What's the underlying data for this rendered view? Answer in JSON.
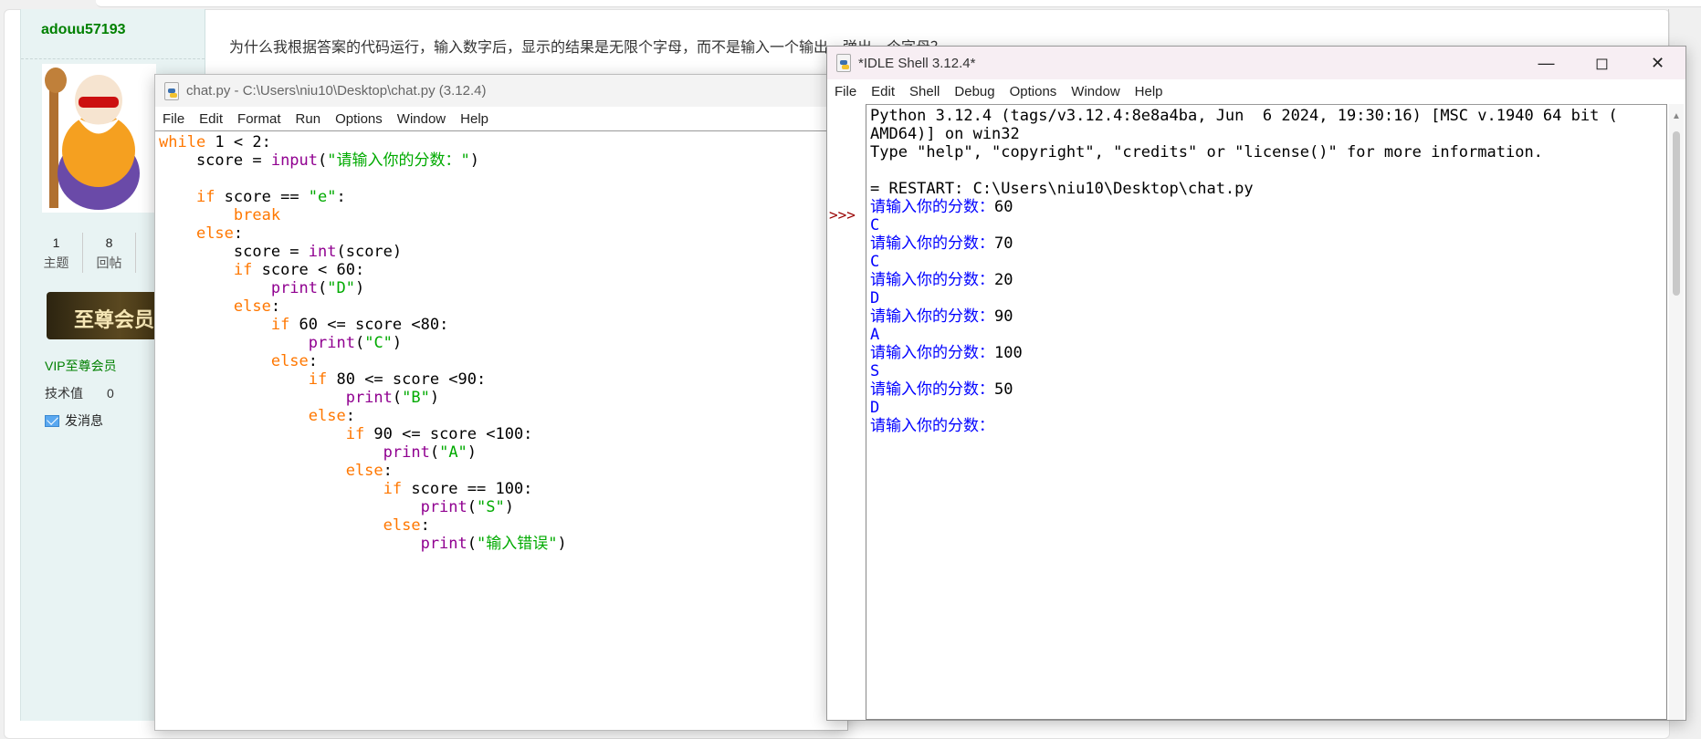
{
  "forum": {
    "username": "adouu57193",
    "stats": [
      {
        "value": "1",
        "label": "主题"
      },
      {
        "value": "8",
        "label": "回帖"
      }
    ],
    "vip_badge": "至尊会员",
    "vip_label": "VIP至尊会员",
    "tech_label": "技术值",
    "tech_value": "0",
    "message": "发消息",
    "question": "为什么我根据答案的代码运行，输入数字后，显示的结果是无限个字母，而不是输入一个输出，弹出一个字母？"
  },
  "editor": {
    "title": "chat.py - C:\\Users\\niu10\\Desktop\\chat.py (3.12.4)",
    "menu": [
      "File",
      "Edit",
      "Format",
      "Run",
      "Options",
      "Window",
      "Help"
    ],
    "code": [
      [
        [
          "kw",
          "while"
        ],
        [
          "tx",
          " 1 < 2:"
        ]
      ],
      [
        [
          "tx",
          "    score = "
        ],
        [
          "bi",
          "input"
        ],
        [
          "tx",
          "("
        ],
        [
          "st",
          "\"请输入你的分数：\""
        ],
        [
          "tx",
          ")"
        ]
      ],
      [
        [
          "tx",
          ""
        ]
      ],
      [
        [
          "tx",
          "    "
        ],
        [
          "kw",
          "if"
        ],
        [
          "tx",
          " score == "
        ],
        [
          "st",
          "\"e\""
        ],
        [
          "tx",
          ":"
        ]
      ],
      [
        [
          "tx",
          "        "
        ],
        [
          "kw",
          "break"
        ]
      ],
      [
        [
          "tx",
          "    "
        ],
        [
          "kw",
          "else"
        ],
        [
          "tx",
          ":"
        ]
      ],
      [
        [
          "tx",
          "        score = "
        ],
        [
          "bi",
          "int"
        ],
        [
          "tx",
          "(score)"
        ]
      ],
      [
        [
          "tx",
          "        "
        ],
        [
          "kw",
          "if"
        ],
        [
          "tx",
          " score < 60:"
        ]
      ],
      [
        [
          "tx",
          "            "
        ],
        [
          "bi",
          "print"
        ],
        [
          "tx",
          "("
        ],
        [
          "st",
          "\"D\""
        ],
        [
          "tx",
          ")"
        ]
      ],
      [
        [
          "tx",
          "        "
        ],
        [
          "kw",
          "else"
        ],
        [
          "tx",
          ":"
        ]
      ],
      [
        [
          "tx",
          "            "
        ],
        [
          "kw",
          "if"
        ],
        [
          "tx",
          " 60 <= score <80:"
        ]
      ],
      [
        [
          "tx",
          "                "
        ],
        [
          "bi",
          "print"
        ],
        [
          "tx",
          "("
        ],
        [
          "st",
          "\"C\""
        ],
        [
          "tx",
          ")"
        ]
      ],
      [
        [
          "tx",
          "            "
        ],
        [
          "kw",
          "else"
        ],
        [
          "tx",
          ":"
        ]
      ],
      [
        [
          "tx",
          "                "
        ],
        [
          "kw",
          "if"
        ],
        [
          "tx",
          " 80 <= score <90:"
        ]
      ],
      [
        [
          "tx",
          "                    "
        ],
        [
          "bi",
          "print"
        ],
        [
          "tx",
          "("
        ],
        [
          "st",
          "\"B\""
        ],
        [
          "tx",
          ")"
        ]
      ],
      [
        [
          "tx",
          "                "
        ],
        [
          "kw",
          "else"
        ],
        [
          "tx",
          ":"
        ]
      ],
      [
        [
          "tx",
          "                    "
        ],
        [
          "kw",
          "if"
        ],
        [
          "tx",
          " 90 <= score <100:"
        ]
      ],
      [
        [
          "tx",
          "                        "
        ],
        [
          "bi",
          "print"
        ],
        [
          "tx",
          "("
        ],
        [
          "st",
          "\"A\""
        ],
        [
          "tx",
          ")"
        ]
      ],
      [
        [
          "tx",
          "                    "
        ],
        [
          "kw",
          "else"
        ],
        [
          "tx",
          ":"
        ]
      ],
      [
        [
          "tx",
          "                        "
        ],
        [
          "kw",
          "if"
        ],
        [
          "tx",
          " score == 100:"
        ]
      ],
      [
        [
          "tx",
          "                            "
        ],
        [
          "bi",
          "print"
        ],
        [
          "tx",
          "("
        ],
        [
          "st",
          "\"S\""
        ],
        [
          "tx",
          ")"
        ]
      ],
      [
        [
          "tx",
          "                        "
        ],
        [
          "kw",
          "else"
        ],
        [
          "tx",
          ":"
        ]
      ],
      [
        [
          "tx",
          "                            "
        ],
        [
          "bi",
          "print"
        ],
        [
          "tx",
          "("
        ],
        [
          "st",
          "\"输入错误\""
        ],
        [
          "tx",
          ")"
        ]
      ]
    ]
  },
  "shell": {
    "title": "*IDLE Shell 3.12.4*",
    "menu": [
      "File",
      "Edit",
      "Shell",
      "Debug",
      "Options",
      "Window",
      "Help"
    ],
    "prompt": ">>>",
    "lines": [
      [
        "tx",
        "Python 3.12.4 (tags/v3.12.4:8e8a4ba, Jun  6 2024, 19:30:16) [MSC v.1940 64 bit ("
      ],
      [
        "tx",
        "AMD64)] on win32"
      ],
      [
        "tx",
        "Type \"help\", \"copyright\", \"credits\" or \"license()\" for more information."
      ],
      [
        "tx",
        ""
      ],
      [
        "tx",
        "= RESTART: C:\\Users\\niu10\\Desktop\\chat.py"
      ],
      [
        "io",
        "请输入你的分数：",
        "60"
      ],
      [
        "stdout",
        "C"
      ],
      [
        "io",
        "请输入你的分数：",
        "70"
      ],
      [
        "stdout",
        "C"
      ],
      [
        "io",
        "请输入你的分数：",
        "20"
      ],
      [
        "stdout",
        "D"
      ],
      [
        "io",
        "请输入你的分数：",
        "90"
      ],
      [
        "stdout",
        "A"
      ],
      [
        "io",
        "请输入你的分数：",
        "100"
      ],
      [
        "stdout",
        "S"
      ],
      [
        "io",
        "请输入你的分数：",
        "50"
      ],
      [
        "stdout",
        "D"
      ],
      [
        "io",
        "请输入你的分数：",
        ""
      ]
    ]
  },
  "colors": {
    "keyword": "#ff7700",
    "builtin": "#900090",
    "string": "#00aa00",
    "stdout": "#0000ff",
    "prompt": "#990000",
    "username": "#008000"
  }
}
